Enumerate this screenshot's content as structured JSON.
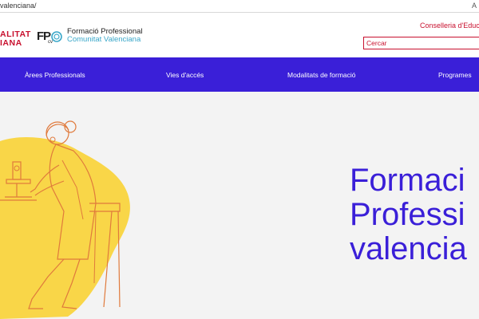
{
  "browser": {
    "url": "valenciana/",
    "right_text": "A"
  },
  "header": {
    "gva_logo_lines": [
      "ALITAT",
      "IANA"
    ],
    "fp_logo_letters": "FPcv",
    "fp_title": "Formació Professional",
    "fp_subtitle": "Comunitat Valenciana",
    "conselleria": "Conselleria d'Educa",
    "search_placeholder": "Cercar"
  },
  "nav": {
    "items": [
      {
        "label": "Àrees Professionals"
      },
      {
        "label": "Vies d'accés"
      },
      {
        "label": "Modalitats de formació"
      },
      {
        "label": "Programes"
      }
    ]
  },
  "hero": {
    "title_lines": [
      "Formaci",
      "Professi",
      "valencia"
    ],
    "illustration": "scientist-with-microscope-illustration"
  },
  "colors": {
    "brand_blue": "#3a1fd8",
    "brand_red": "#c8102e",
    "blob_yellow": "#f9d648",
    "line_orange": "#e07a3c"
  }
}
